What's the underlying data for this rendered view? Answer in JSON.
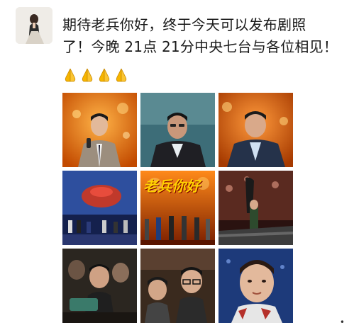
{
  "post": {
    "text": "期待老兵你好，终于于今天可以发布剧照了！今晚 21点 21分中央七台与各位相见！",
    "line1": "期待老兵你好，终于今天可以发布剧照",
    "line2": "了！今晚 21点 21分中央七台与各位相见！",
    "emojis": [
      "prayer-hands-icon",
      "prayer-hands-icon",
      "prayer-hands-icon",
      "prayer-hands-icon"
    ]
  },
  "photo_grid": {
    "columns": 3,
    "rows": 3,
    "tile_5_title": "老兵你好"
  },
  "colors": {
    "text": "#1a1a1a",
    "emoji_yellow": "#f7b500"
  }
}
